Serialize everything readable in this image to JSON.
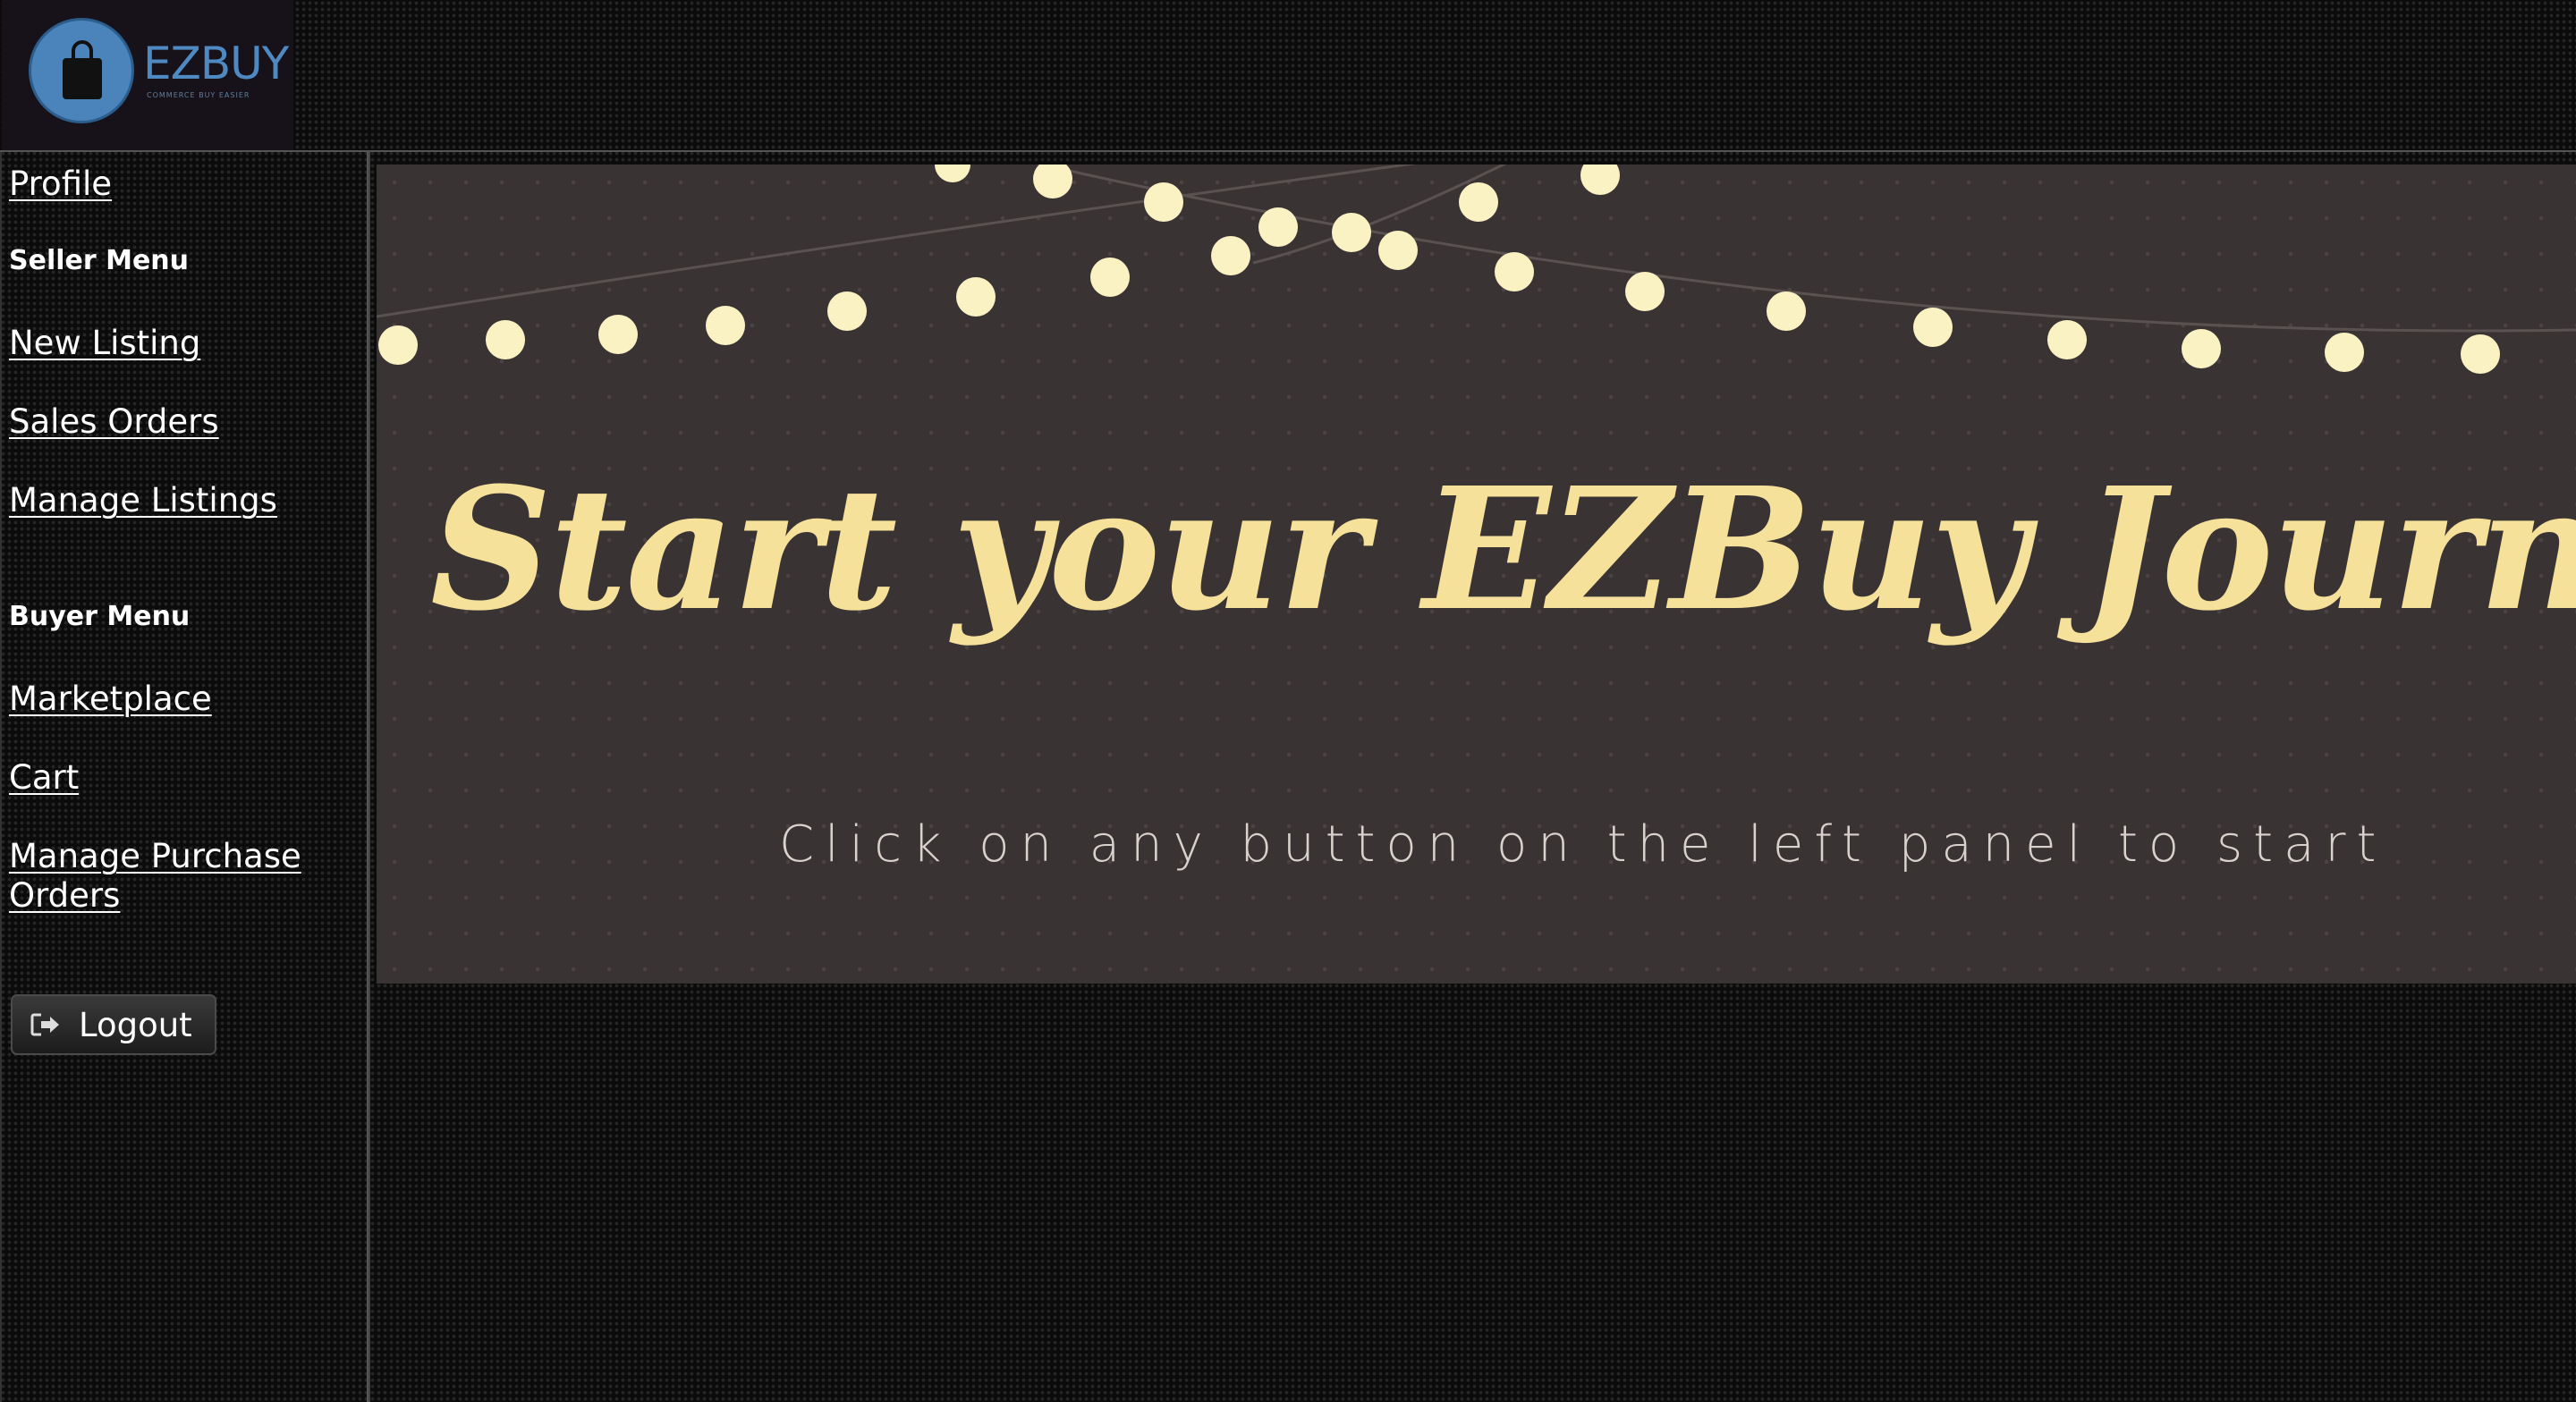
{
  "header": {
    "logo_text": "EZBUY",
    "logo_tagline": "COMMERCE BUY EASIER"
  },
  "sidebar": {
    "profile_label": "Profile",
    "seller_menu_heading": "Seller Menu",
    "seller_items": [
      "New Listing",
      "Sales Orders",
      "Manage Listings"
    ],
    "buyer_menu_heading": "Buyer Menu",
    "buyer_items": [
      "Marketplace",
      "Cart",
      "Manage Purchase Orders"
    ],
    "logout_label": "Logout"
  },
  "banner": {
    "title": "Start your EZBuy  Journey Now",
    "subtitle": "Click on any button on the left panel to start"
  },
  "colors": {
    "banner_background": "#3a3333",
    "title_color": "#f5e19a",
    "bulb_color": "#fbf2c4",
    "logo_blue": "#4b84bb"
  }
}
